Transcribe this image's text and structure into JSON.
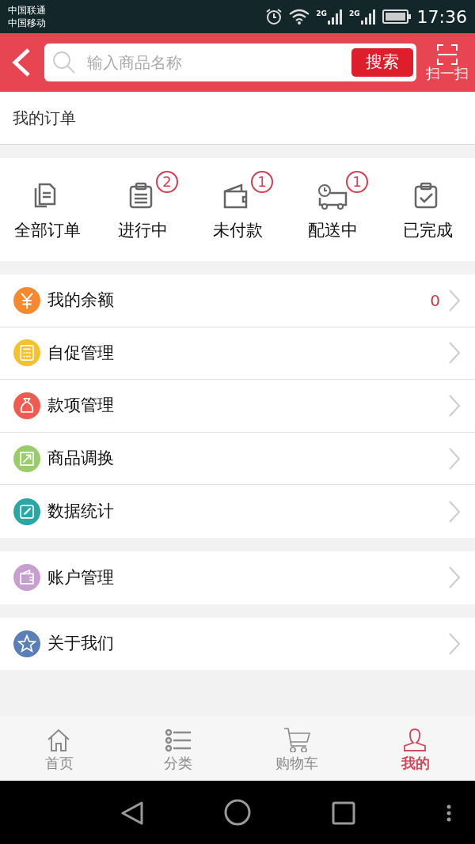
{
  "status_bar": {
    "carriers": [
      "中国联通",
      "中国移动"
    ],
    "time": "17:36",
    "signal_labels": [
      "2G",
      "2G"
    ]
  },
  "header": {
    "search": {
      "placeholder": "输入商品名称"
    },
    "search_button": "搜索",
    "scan_label": "扫一扫"
  },
  "orders_title": "我的订单",
  "order_statuses": [
    {
      "label": "全部订单"
    },
    {
      "label": "进行中",
      "badge": "2"
    },
    {
      "label": "未付款",
      "badge": "1"
    },
    {
      "label": "配送中",
      "badge": "1"
    },
    {
      "label": "已完成"
    }
  ],
  "menu_groups": [
    [
      {
        "label": "我的余额",
        "color": "#f5892e",
        "value": "0"
      },
      {
        "label": "自促管理",
        "color": "#f6c02f"
      },
      {
        "label": "款项管理",
        "color": "#f05a4f"
      },
      {
        "label": "商品调换",
        "color": "#9acd6a"
      },
      {
        "label": "数据统计",
        "color": "#2aa6a4"
      }
    ],
    [
      {
        "label": "账户管理",
        "color": "#c69ed0"
      }
    ],
    [
      {
        "label": "关于我们",
        "color": "#5a7fb8"
      }
    ]
  ],
  "tabs": [
    {
      "label": "首页",
      "selected": false
    },
    {
      "label": "分类",
      "selected": false
    },
    {
      "label": "购物车",
      "selected": false
    },
    {
      "label": "我的",
      "selected": true
    }
  ]
}
